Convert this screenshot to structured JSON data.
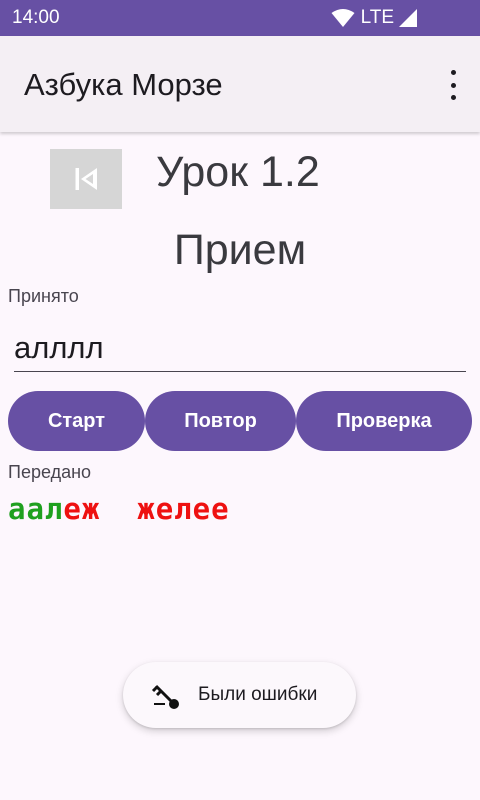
{
  "status_bar": {
    "time": "14:00",
    "network": "LTE"
  },
  "app_bar": {
    "title": "Азбука Морзе",
    "menu_icon": "overflow-menu-icon"
  },
  "lesson": {
    "title": "Урок 1.2",
    "mode": "Прием",
    "prev_icon": "skip-previous-icon"
  },
  "received": {
    "label": "Принято",
    "value": "алллл"
  },
  "buttons": {
    "start": "Старт",
    "repeat": "Повтор",
    "check": "Проверка"
  },
  "transmitted": {
    "label": "Передано",
    "segments": [
      {
        "text": "аал",
        "color": "#1fa01f"
      },
      {
        "text": "еж  желее",
        "color": "#ee1111"
      }
    ]
  },
  "snackbar": {
    "text": "Были ошибки",
    "icon": "key-icon"
  },
  "colors": {
    "accent": "#6750a4",
    "correct": "#1fa01f",
    "wrong": "#ee1111"
  }
}
